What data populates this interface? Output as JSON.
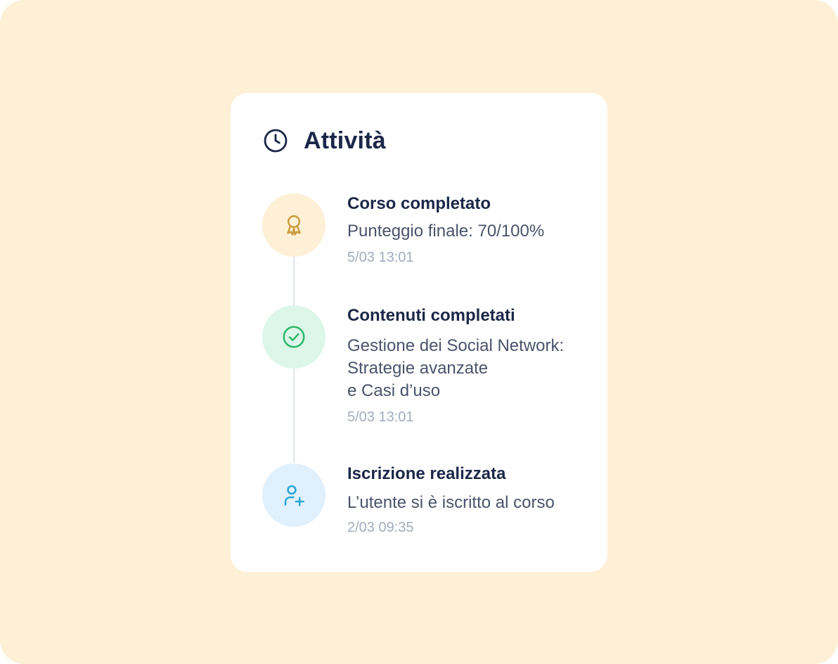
{
  "panel": {
    "title": "Attività",
    "header_icon": "clock-icon"
  },
  "events": [
    {
      "title": "Corso completato",
      "description": [
        "Punteggio finale: 70/100%"
      ],
      "time": "5/03 13:01",
      "icon": "award-ribbon-icon",
      "icon_color": "#c99a3c",
      "icon_bg": "#fdf0d6"
    },
    {
      "title": "Contenuti completati",
      "description": [
        "Gestione dei Social Network:",
        "Strategie avanzate",
        "e Casi d’uso"
      ],
      "time": "5/03 13:01",
      "icon": "check-circle-icon",
      "icon_color": "#2fb86b",
      "icon_bg": "#dcf7ea"
    },
    {
      "title": "Iscrizione realizzata",
      "description": [
        "L’utente si è iscritto al corso"
      ],
      "time": "2/03 09:35",
      "icon": "user-plus-icon",
      "icon_color": "#29a8d8",
      "icon_bg": "#e0f0fc"
    }
  ],
  "colors": {
    "backdrop": "#fdf0d6",
    "card": "#ffffff",
    "title_text": "#1c2748",
    "body_text": "#4a536b",
    "muted_text": "#a3abbc",
    "timeline_line": "#e2e6ee"
  }
}
